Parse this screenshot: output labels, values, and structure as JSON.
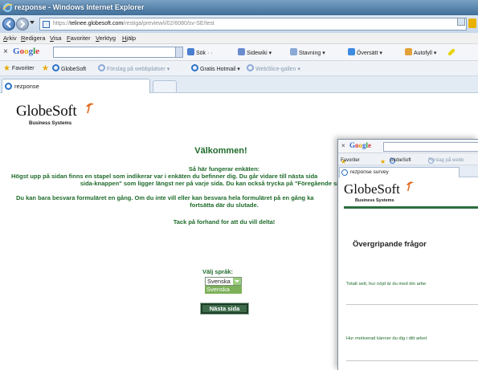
{
  "window": {
    "title": "rezponse - Windows Internet Explorer"
  },
  "address": {
    "url_prefix": "https://",
    "url_host": "telinee.globesoft.com",
    "url_path": "/restiga/preview/i/02/6080/sv-SE/test"
  },
  "menu": [
    "Arkiv",
    "Redigera",
    "Visa",
    "Favoriter",
    "Verktyg",
    "Hjälp"
  ],
  "google_toolbar": {
    "logo": "Google",
    "tools": [
      "Sök",
      "Sidewiki",
      "Stavning",
      "Översätt",
      "Autofyll"
    ]
  },
  "favorites_bar": {
    "favorites_label": "Favoriter",
    "links": [
      {
        "label": "GlobeSoft",
        "dim": false
      },
      {
        "label": "Förslag på webbplatser",
        "dim": true
      },
      {
        "label": "Gratis Hotmail",
        "dim": false
      },
      {
        "label": "WebSlice-gallen",
        "dim": true
      }
    ]
  },
  "tab": {
    "label": "rezponse"
  },
  "page": {
    "logo_name": "GlobeSoft",
    "logo_sub": "Business Systems",
    "welcome": "Välkommen!",
    "how_heading": "Så här fungerar enkäten:",
    "para1_line1": "Högst upp på sidan finns en stapel som indikerar var i enkäten du befinner dig. Du går vidare till nästa sida",
    "para1_line2": "sida-knappen\" som ligger längst ner på varje sida. Du kan också trycka på \"Föregående sida\"-knapp",
    "para2_line1": "Du kan bara besvara formuläret en gång. Om du inte vill eller kan besvara hela formuläret på en gång ka",
    "para2_line2": "fortsätta där du slutade.",
    "thanks": "Tack på forhand for att du vill delta!",
    "language_label": "Välj språk:",
    "language_selected": "Svenska",
    "language_option": "Svenska",
    "next_button": "Nästa sida"
  },
  "overlay": {
    "google_logo": "Google",
    "fav_label": "Favoriter",
    "fav_link1": "GlobeSoft",
    "fav_link2": "Förslag på webb",
    "tab_label": "rezponse survey",
    "logo_name": "GlobeSoft",
    "logo_sub": "Business Systems",
    "heading": "Övergripande frågor",
    "question1": "Totalt sett, hur nöjd är du med din arbe",
    "question2": "Hur motiverad känner du dig i ditt arbet"
  },
  "colors": {
    "accent_green": "#1e6b2a",
    "button_green": "#3d6b4a",
    "select_green": "#7cb15a"
  }
}
